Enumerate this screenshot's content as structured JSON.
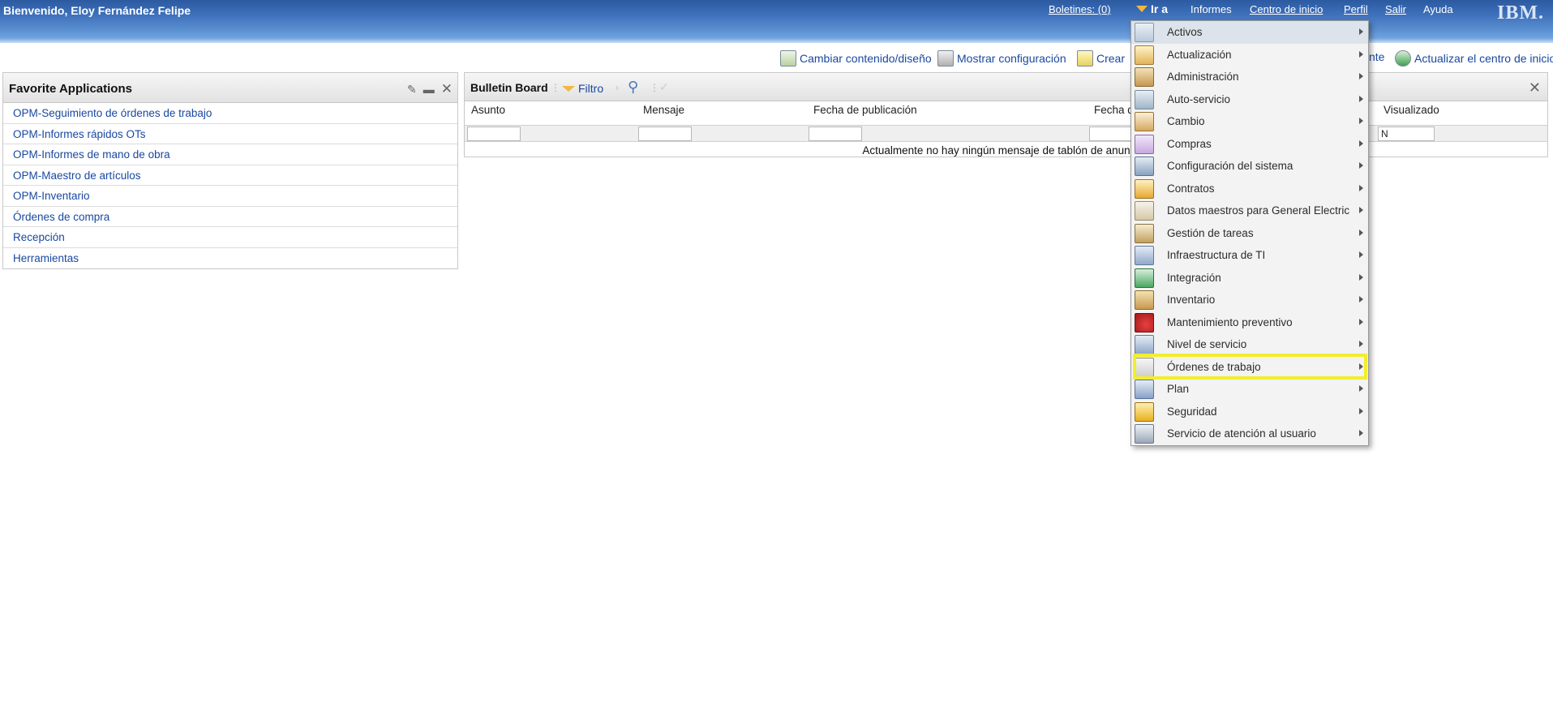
{
  "header": {
    "welcome": "Bienvenido, Eloy Fernández Felipe",
    "links": {
      "boletines": "Boletines: (0)",
      "ira": "Ir a",
      "informes": "Informes",
      "centro": "Centro de inicio",
      "perfil": "Perfil",
      "salir": "Salir",
      "ayuda": "Ayuda"
    },
    "logo": "IBM."
  },
  "toolbar": {
    "cambiar": "Cambiar contenido/diseño",
    "mostrar": "Mostrar configuración",
    "crear": "Crear",
    "nte": "nte",
    "actualizar": "Actualizar el centro de inicio"
  },
  "favorites": {
    "title": "Favorite Applications",
    "items": [
      "OPM-Seguimiento de órdenes de trabajo",
      "OPM-Informes rápidos OTs",
      "OPM-Informes de mano de obra",
      "OPM-Maestro de artículos",
      "OPM-Inventario",
      "Órdenes de compra",
      "Recepción",
      "Herramientas"
    ]
  },
  "bulletin": {
    "title": "Bulletin Board",
    "filter": "Filtro",
    "columns": {
      "asunto": "Asunto",
      "mensaje": "Mensaje",
      "fecha_pub": "Fecha de publicación",
      "fecha_trunc": "Fecha d",
      "visualizado": "Visualizado"
    },
    "visualizado_filter": "N",
    "empty": "Actualmente no hay ningún mensaje de tablón de anuncios"
  },
  "menu": {
    "items": [
      {
        "label": "Activos",
        "icon": "activos-icon"
      },
      {
        "label": "Actualización",
        "icon": "actualizacion-icon"
      },
      {
        "label": "Administración",
        "icon": "administracion-icon"
      },
      {
        "label": "Auto-servicio",
        "icon": "auto-servicio-icon"
      },
      {
        "label": "Cambio",
        "icon": "cambio-icon"
      },
      {
        "label": "Compras",
        "icon": "compras-icon"
      },
      {
        "label": "Configuración del sistema",
        "icon": "configuracion-icon"
      },
      {
        "label": "Contratos",
        "icon": "contratos-icon"
      },
      {
        "label": "Datos maestros para General Electric",
        "icon": "datos-maestros-icon"
      },
      {
        "label": "Gestión de tareas",
        "icon": "gestion-tareas-icon"
      },
      {
        "label": "Infraestructura de TI",
        "icon": "infraestructura-icon"
      },
      {
        "label": "Integración",
        "icon": "integracion-icon"
      },
      {
        "label": "Inventario",
        "icon": "inventario-icon"
      },
      {
        "label": "Mantenimiento preventivo",
        "icon": "mantenimiento-icon"
      },
      {
        "label": "Nivel de servicio",
        "icon": "nivel-servicio-icon"
      },
      {
        "label": "Órdenes de trabajo",
        "icon": "ordenes-trabajo-icon"
      },
      {
        "label": "Plan",
        "icon": "plan-icon"
      },
      {
        "label": "Seguridad",
        "icon": "seguridad-icon"
      },
      {
        "label": "Servicio de atención al usuario",
        "icon": "servicio-atencion-icon"
      }
    ],
    "highlighted_index": 15,
    "highlight_color": "#f2ee2a"
  },
  "colors": {
    "header_blue": "#3b6db8",
    "link_blue": "#1a48a0"
  }
}
